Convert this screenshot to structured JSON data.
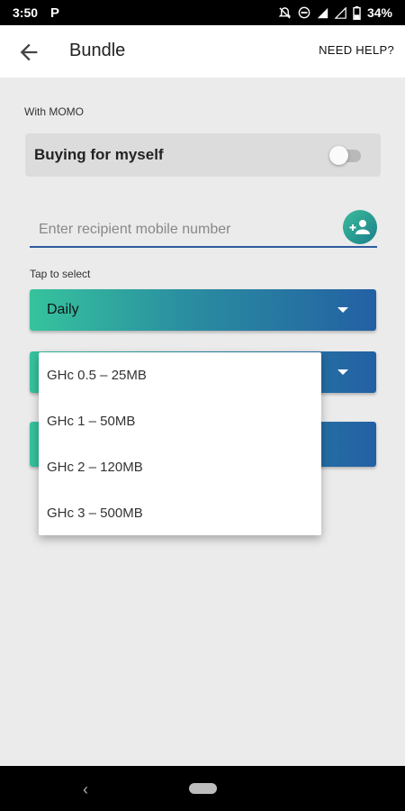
{
  "status_bar": {
    "time": "3:50",
    "app_icon_letter": "P",
    "battery_percent": "34%"
  },
  "app_bar": {
    "title": "Bundle",
    "help_label": "NEED HELP?"
  },
  "payment": {
    "method_label": "With MOMO"
  },
  "self_toggle": {
    "label": "Buying for myself",
    "checked": false
  },
  "recipient": {
    "placeholder": "Enter recipient mobile number",
    "value": ""
  },
  "selector": {
    "hint": "Tap to select",
    "period_value": "Daily"
  },
  "bundle_menu": {
    "options": [
      "GHc 0.5 – 25MB",
      "GHc 1 – 50MB",
      "GHc 2 – 120MB",
      "GHc 3 – 500MB"
    ]
  },
  "colors": {
    "gradient_start": "#36c39d",
    "gradient_end": "#2360a4",
    "input_underline": "#2e5a9e"
  }
}
